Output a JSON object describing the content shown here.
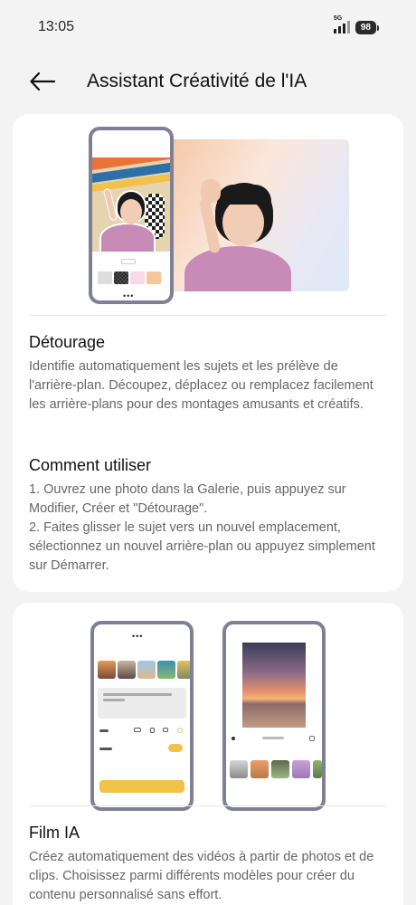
{
  "status": {
    "time": "13:05",
    "network": "5G",
    "battery": "98"
  },
  "header": {
    "back_icon": "arrow-left-icon",
    "title": "Assistant Créativité de l'IA"
  },
  "cards": [
    {
      "id": "detourage",
      "feature_title": "Détourage",
      "feature_description": "Identifie automatiquement les sujets et les prélève de l'arrière-plan. Découpez, déplacez ou remplacez facilement les arrière-plans pour des montages amusants et créatifs.",
      "howto_title": "Comment utiliser",
      "howto_steps": "1. Ouvrez une photo dans la Galerie, puis appuyez sur Modifier, Créer et \"Détourage\".\n2. Faites glisser le sujet vers un nouvel emplacement, sélectionnez un nouvel arrière-plan ou appuyez simplement sur Démarrer."
    },
    {
      "id": "film-ia",
      "feature_title": "Film IA",
      "feature_description": "Créez automatiquement des vidéos à partir de photos et de clips. Choisissez parmi différents modèles pour créer du contenu personnalisé sans effort."
    }
  ]
}
